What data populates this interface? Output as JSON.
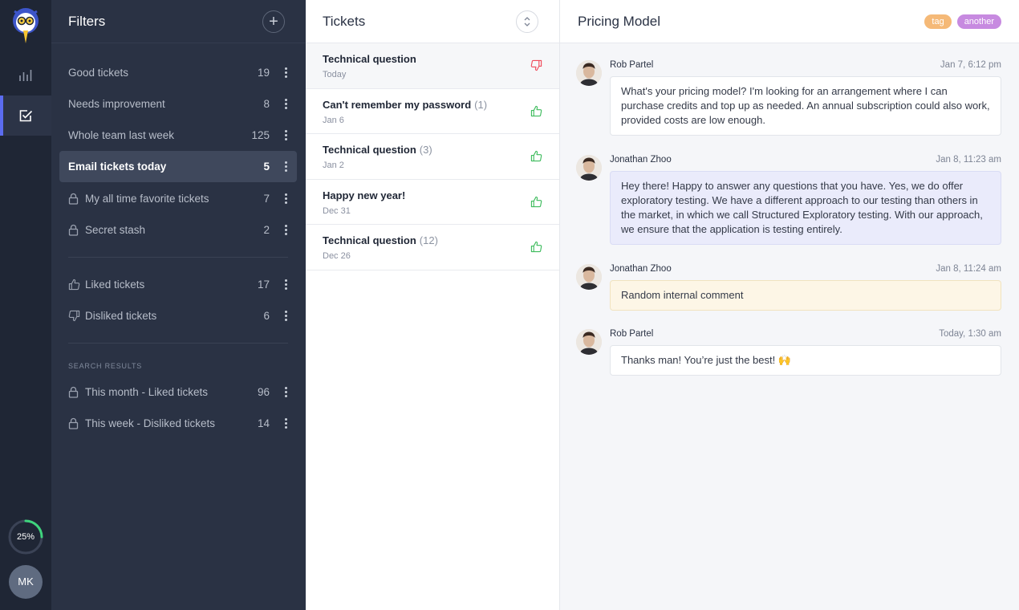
{
  "rail": {
    "progress_value": 0.25,
    "progress_label": "25%",
    "avatar_initials": "MK"
  },
  "filters": {
    "title": "Filters",
    "items": [
      {
        "label": "Good tickets",
        "count": "19",
        "icon": ""
      },
      {
        "label": "Needs improvement",
        "count": "8",
        "icon": ""
      },
      {
        "label": "Whole team last week",
        "count": "125",
        "icon": ""
      },
      {
        "label": "Email tickets today",
        "count": "5",
        "icon": "",
        "active": true
      },
      {
        "label": "My all time favorite tickets",
        "count": "7",
        "icon": "lock-icon"
      },
      {
        "label": "Secret stash",
        "count": "2",
        "icon": "lock-icon"
      },
      {
        "label": "Liked tickets",
        "count": "17",
        "icon": "thumbs-up-icon"
      },
      {
        "label": "Disliked tickets",
        "count": "6",
        "icon": "thumbs-down-icon"
      },
      {
        "label": "This month - Liked tickets",
        "count": "96",
        "icon": "lock-icon"
      },
      {
        "label": "This week - Disliked tickets",
        "count": "14",
        "icon": "lock-icon"
      }
    ],
    "section_label": "SEARCH RESULTS"
  },
  "tickets": {
    "title": "Tickets",
    "items": [
      {
        "title": "Technical question",
        "count": "",
        "date": "Today",
        "rating": "thumbs-down-icon"
      },
      {
        "title": "Can't remember my password",
        "count": "(1)",
        "date": "Jan 6",
        "rating": "thumbs-up-icon"
      },
      {
        "title": "Technical question",
        "count": "(3)",
        "date": "Jan 2",
        "rating": "thumbs-up-icon"
      },
      {
        "title": "Happy new year!",
        "count": "",
        "date": "Dec 31",
        "rating": "thumbs-up-icon"
      },
      {
        "title": "Technical question",
        "count": "(12)",
        "date": "Dec 26",
        "rating": "thumbs-up-icon"
      }
    ]
  },
  "detail": {
    "title": "Pricing Model",
    "tags": [
      {
        "label": "tag",
        "color": "#f5b977"
      },
      {
        "label": "another",
        "color": "#c78ae0"
      }
    ],
    "messages": [
      {
        "author": "Rob Partel",
        "time": "Jan 7, 6:12 pm",
        "text": "What's your pricing model? I'm looking for an arrangement where I can purchase credits and top up as needed. An annual subscription could also work, provided costs are low enough.",
        "style": "plain"
      },
      {
        "author": "Jonathan Zhoo",
        "time": "Jan 8, 11:23 am",
        "text": "Hey there! Happy to answer any questions that you have. Yes, we do offer exploratory testing. We have a different approach to our testing than others in the market, in which we call Structured Exploratory testing. With our approach, we ensure that the application is testing entirely.",
        "style": "blue"
      },
      {
        "author": "Jonathan Zhoo",
        "time": "Jan 8, 11:24 am",
        "text": "Random internal comment",
        "style": "yellow"
      },
      {
        "author": "Rob Partel",
        "time": "Today, 1:30 am",
        "text": "Thanks man! You’re just the best! 🙌",
        "style": "plain"
      }
    ]
  }
}
